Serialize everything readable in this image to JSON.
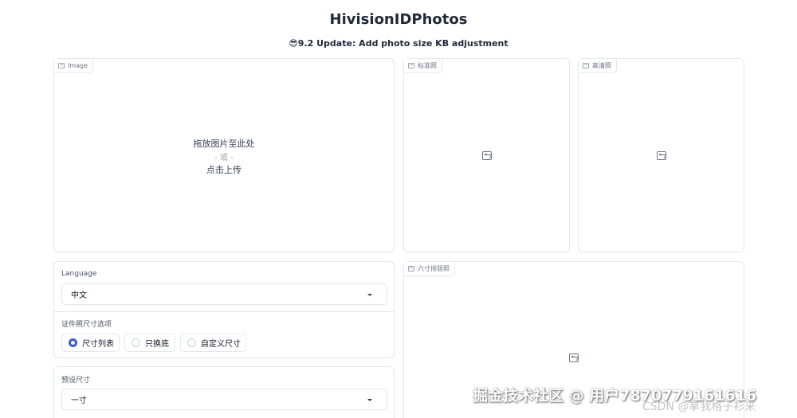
{
  "app": {
    "title": "HivisionIDPhotos",
    "update_banner": "😎9.2 Update: Add photo size KB adjustment"
  },
  "upload_panel": {
    "label": "Image",
    "drop_text": "拖放图片至此处",
    "or_text": "- 或 -",
    "click_text": "点击上传"
  },
  "outputs": {
    "standard_label": "标准照",
    "hd_label": "高清照",
    "layout_label": "六寸排版照"
  },
  "settings": {
    "language_label": "Language",
    "language_value": "中文",
    "size_option_label": "证件照尺寸选项",
    "size_options": [
      "尺寸列表",
      "只换底",
      "自定义尺寸"
    ],
    "selected_size_option": "尺寸列表",
    "preset_size_label": "预设尺寸",
    "preset_size_value": "一寸"
  },
  "watermark": {
    "text": "掘金技术社区 @ 用户7870779161616",
    "csdn_text": "CSDN @拿我格子衫来"
  }
}
